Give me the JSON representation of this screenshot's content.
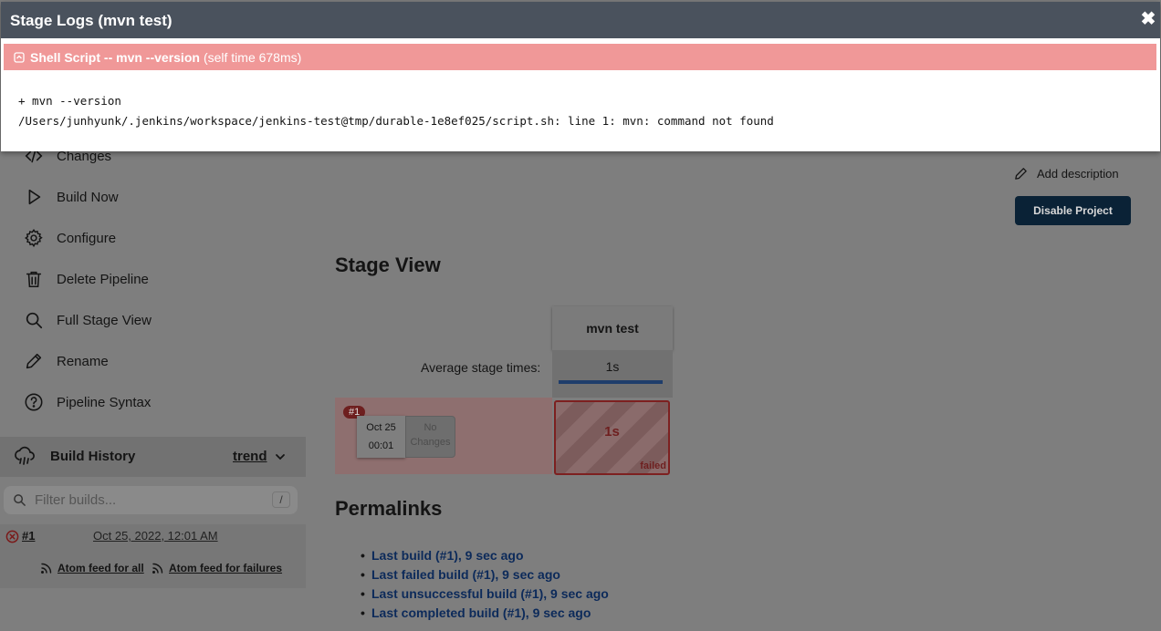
{
  "modal": {
    "title": "Stage Logs (mvn test)",
    "close_label": "✖",
    "step": {
      "name": "Shell Script -- mvn --version",
      "self_time": "(self time 678ms)"
    },
    "log_lines": [
      "+ mvn --version",
      "/Users/junhyunk/.jenkins/workspace/jenkins-test@tmp/durable-1e8ef025/script.sh: line 1: mvn: command not found"
    ]
  },
  "sidebar": {
    "items": [
      {
        "label": "Changes",
        "icon": "code-icon"
      },
      {
        "label": "Build Now",
        "icon": "play-icon"
      },
      {
        "label": "Configure",
        "icon": "gear-icon"
      },
      {
        "label": "Delete Pipeline",
        "icon": "trash-icon"
      },
      {
        "label": "Full Stage View",
        "icon": "search-icon"
      },
      {
        "label": "Rename",
        "icon": "pencil-icon"
      },
      {
        "label": "Pipeline Syntax",
        "icon": "help-icon"
      }
    ]
  },
  "build_history": {
    "title": "Build History",
    "trend_label": "trend",
    "filter_placeholder": "Filter builds...",
    "filter_shortcut": "/",
    "builds": [
      {
        "number": "#1",
        "date": "Oct 25, 2022, 12:01 AM",
        "status": "failed"
      }
    ],
    "feed_all": "Atom feed for all",
    "feed_failures": "Atom feed for failures"
  },
  "header_actions": {
    "add_description": "Add description",
    "disable_project": "Disable Project"
  },
  "stage_view": {
    "title": "Stage View",
    "stage_name": "mvn test",
    "average_label": "Average stage times:",
    "average_time": "1s",
    "run": {
      "badge": "#1",
      "date": "Oct 25",
      "time": "00:01",
      "changes": "No Changes",
      "stage_time": "1s",
      "stage_status": "failed"
    }
  },
  "permalinks": {
    "title": "Permalinks",
    "links": [
      "Last build (#1), 9 sec ago",
      "Last failed build (#1), 9 sec ago",
      "Last unsuccessful build (#1), 9 sec ago",
      "Last completed build (#1), 9 sec ago"
    ]
  },
  "colors": {
    "modal_header": "#4a525d",
    "step_failed": "#f09898",
    "disable_button": "#0a2236"
  }
}
